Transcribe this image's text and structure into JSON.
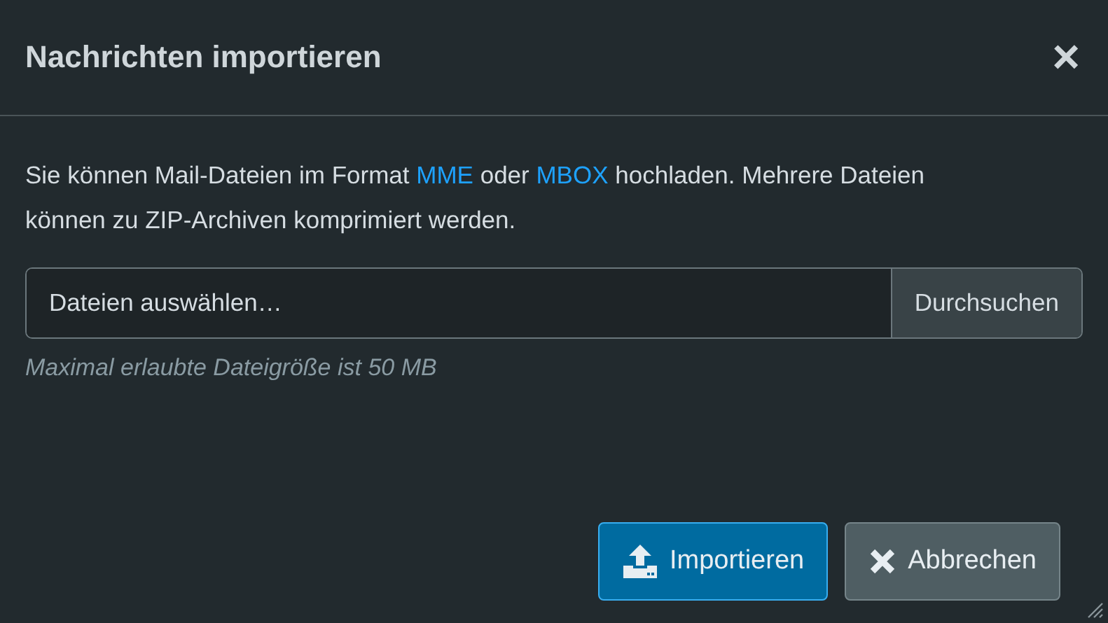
{
  "dialog": {
    "title": "Nachrichten importieren",
    "close": "×"
  },
  "description": [
    {
      "kind": "text",
      "text": "Sie können Mail-Dateien im Format "
    },
    {
      "kind": "link",
      "text": "MME"
    },
    {
      "kind": "text",
      "text": " oder "
    },
    {
      "kind": "link",
      "text": "MBOX"
    },
    {
      "kind": "text",
      "text": " hochladen. Mehrere Dateien können zu ZIP-Archiven komprimiert werden."
    }
  ],
  "file_input": {
    "placeholder": "Dateien auswählen…",
    "button": "Durchsuchen"
  },
  "help_text": "Maximal erlaubte Dateigröße ist 50 MB",
  "buttons": [
    {
      "kind": "primary",
      "label": "Importieren"
    },
    {
      "kind": "secondary",
      "label": "Abbrechen"
    }
  ]
}
